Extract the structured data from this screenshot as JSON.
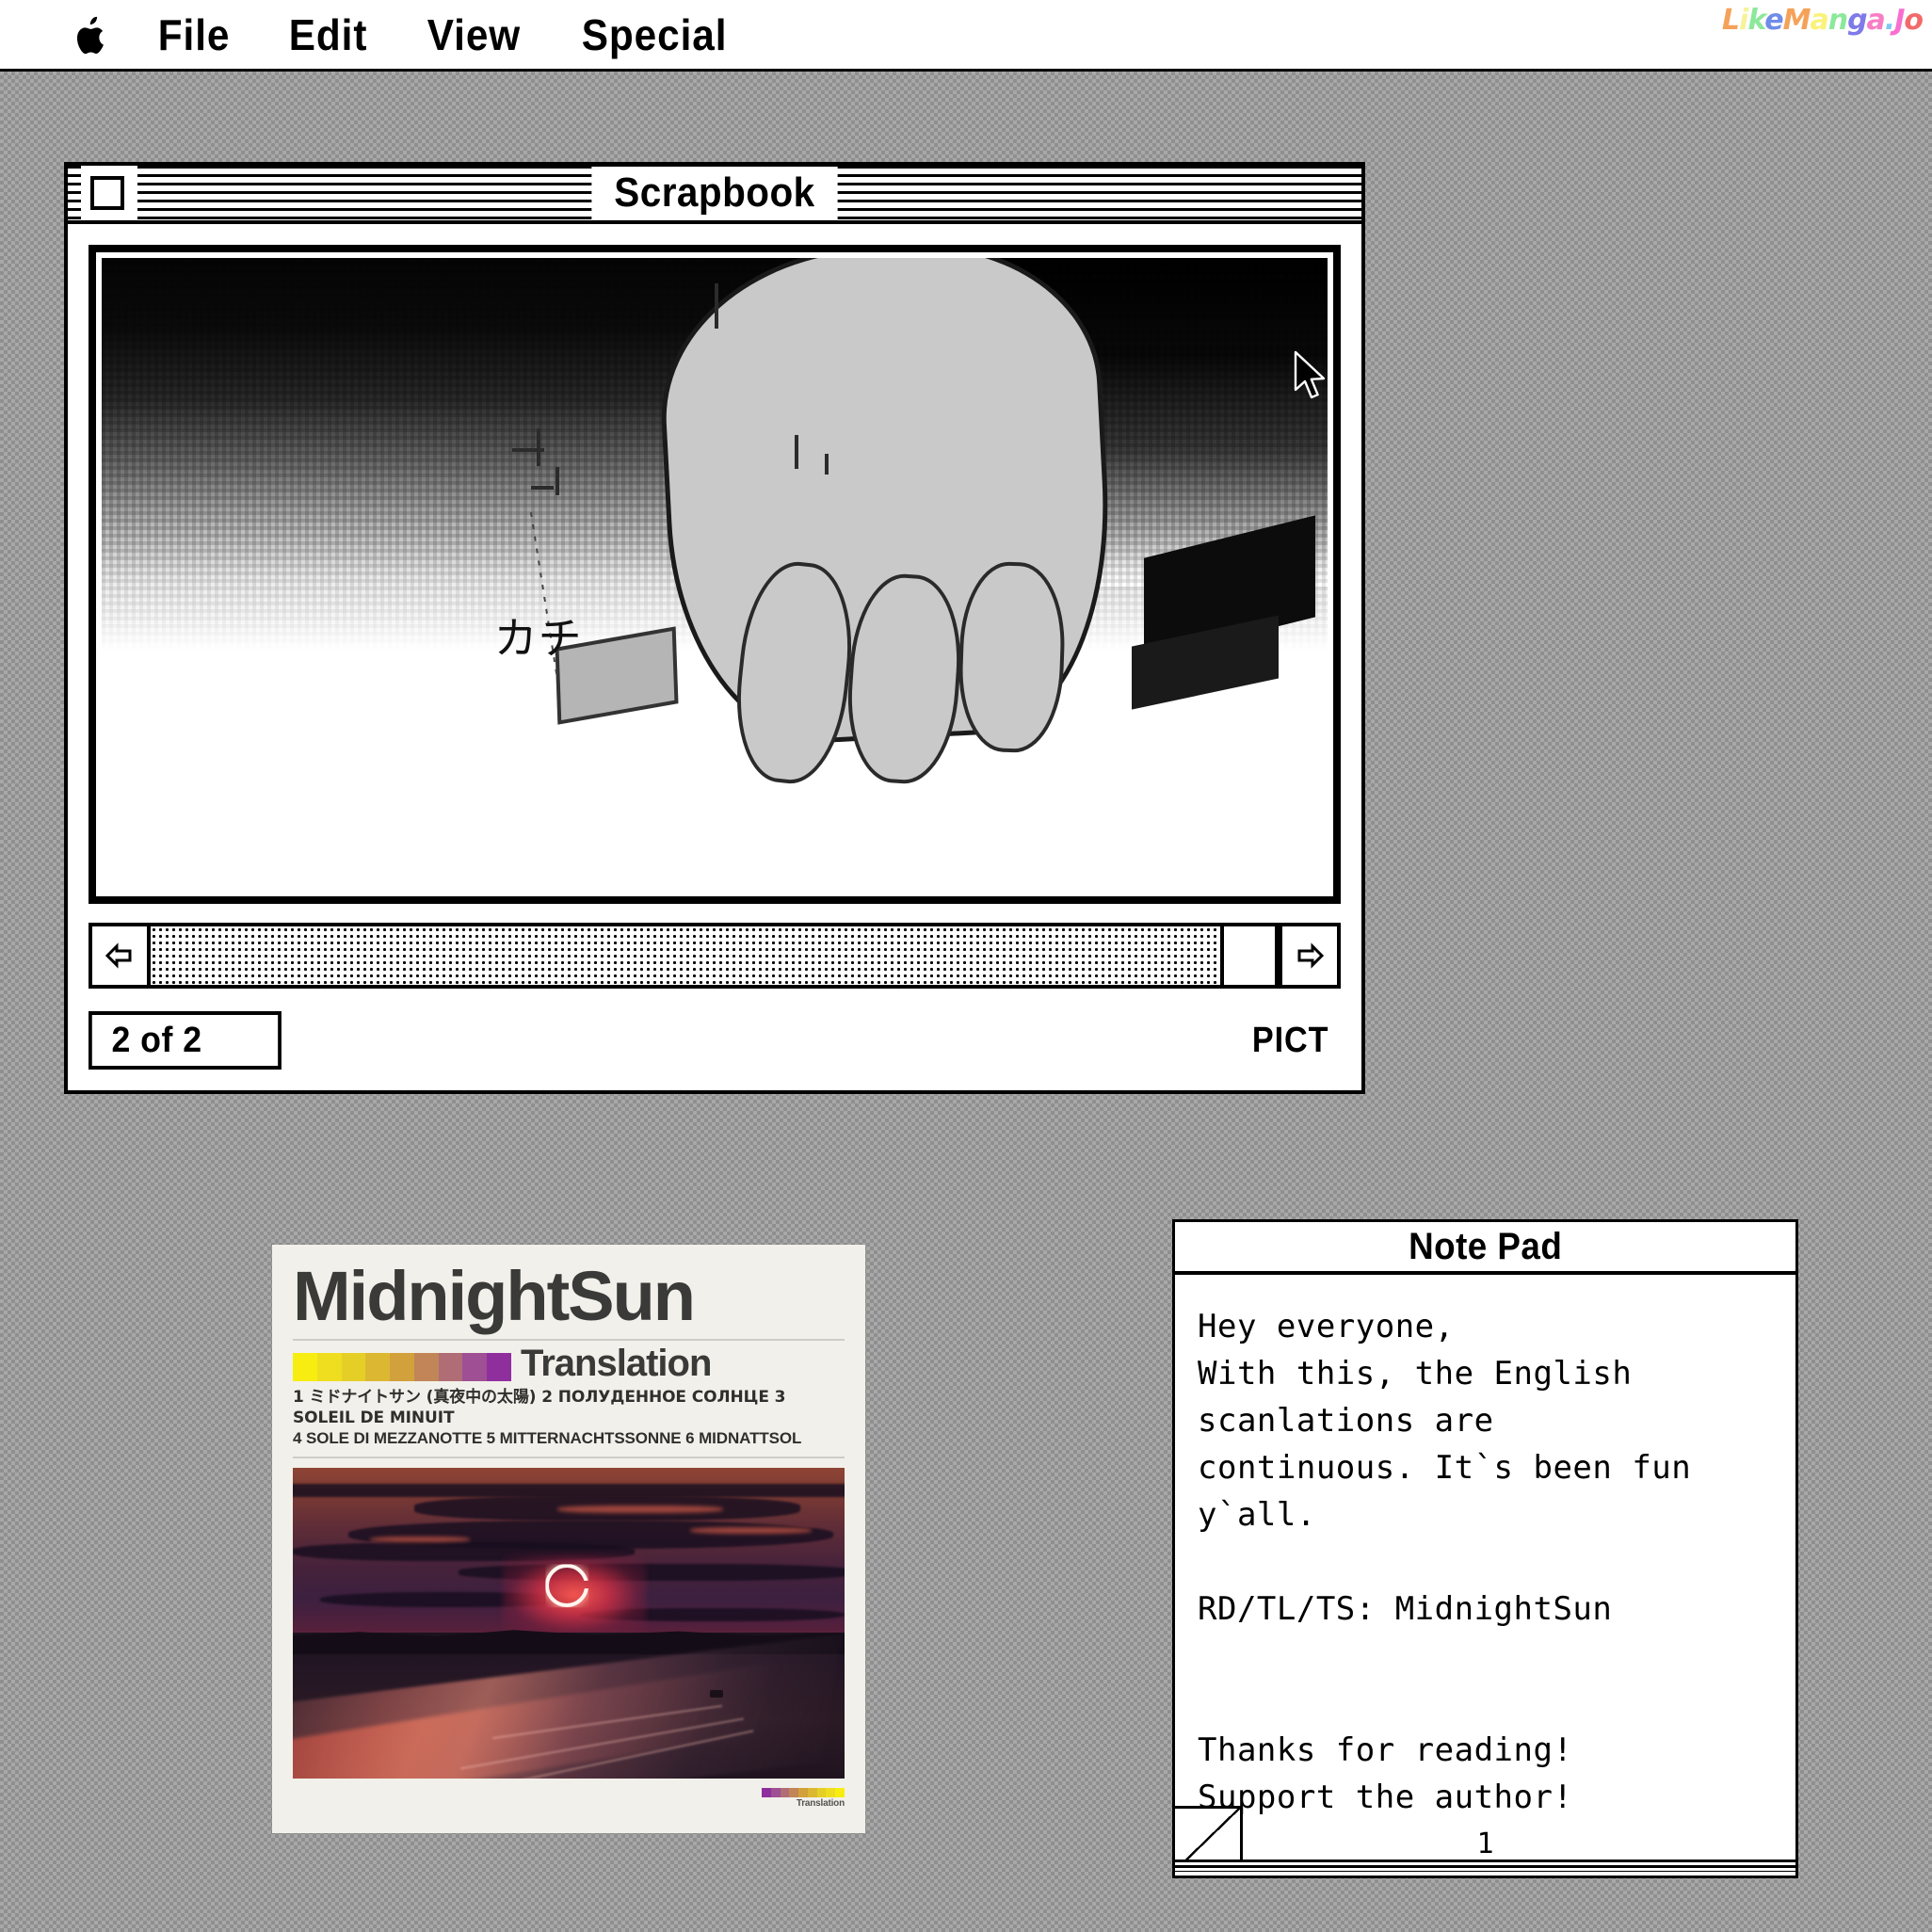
{
  "menubar": {
    "apple_icon": "apple-logo-icon",
    "items": [
      {
        "label": "File"
      },
      {
        "label": "Edit"
      },
      {
        "label": "View"
      },
      {
        "label": "Special"
      }
    ],
    "watermark": {
      "text": "LikeManga.io",
      "letters": [
        {
          "ch": "L",
          "color": "#f5a259"
        },
        {
          "ch": "i",
          "color": "#f7f39a"
        },
        {
          "ch": "k",
          "color": "#8ce89b"
        },
        {
          "ch": "e",
          "color": "#6f8ce8"
        },
        {
          "ch": "M",
          "color": "#f5a259"
        },
        {
          "ch": "a",
          "color": "#faf27a"
        },
        {
          "ch": "n",
          "color": "#8ce89b"
        },
        {
          "ch": "g",
          "color": "#7f7ae8"
        },
        {
          "ch": "a",
          "color": "#f87dc4"
        },
        {
          "ch": ".",
          "color": "#7ec8f5"
        },
        {
          "ch": "J",
          "color": "#f86fd0"
        },
        {
          "ch": "o",
          "color": "#f26a6a"
        }
      ]
    }
  },
  "scrapbook": {
    "title": "Scrapbook",
    "close_box": "close-box",
    "counter": "2 of 2",
    "format_label": "PICT",
    "scroll": {
      "left_arrow": "scroll-left-arrow-icon",
      "right_arrow": "scroll-right-arrow-icon",
      "thumb_position": "near-right"
    },
    "artwork": {
      "description": "pixelated black and white manga panel of a hand",
      "kana": "カチ"
    }
  },
  "card": {
    "title": "MidnightSun",
    "translation_word": "Translation",
    "languages_line1": "1 ミドナイトサン (真夜中の太陽) 2 ПОЛУДЕННОЕ СОЛНЦЕ 3 SOLEIL DE MINUIT",
    "languages_line2": "4 SOLE DI MEZZANOTTE 5 MITTERNACHTSSONNE 6 MIDNATTSOL",
    "footer_label": "Translation",
    "swatch_colors": [
      "#f7ed10",
      "#eede1f",
      "#e5cf27",
      "#dcb832",
      "#d2a13c",
      "#c18558",
      "#b06d75",
      "#9f4f93",
      "#8f2f9e"
    ],
    "mini_swatch_colors": [
      "#8f2f9e",
      "#9f4f93",
      "#b06d75",
      "#c18558",
      "#d2a13c",
      "#dcb832",
      "#e5cf27",
      "#eede1f",
      "#f7ed10"
    ],
    "background_color": "#f2f0ea",
    "text_color": "#3a3a38",
    "artwork": {
      "description": "red sunset eclipse over a highway"
    }
  },
  "notepad": {
    "title": "Note Pad",
    "lines": [
      "Hey everyone,",
      "With this, the English",
      "scanlations are",
      "continuous. It`s been fun",
      "y`all.",
      "",
      "RD/TL/TS: MidnightSun",
      "",
      "",
      "Thanks for reading!",
      "Support the author!"
    ],
    "page_number": "1",
    "corner_fold": "page-corner-fold"
  },
  "desktop": {
    "pattern": "checkerboard-50-percent",
    "cursor": "arrow-pointer"
  }
}
